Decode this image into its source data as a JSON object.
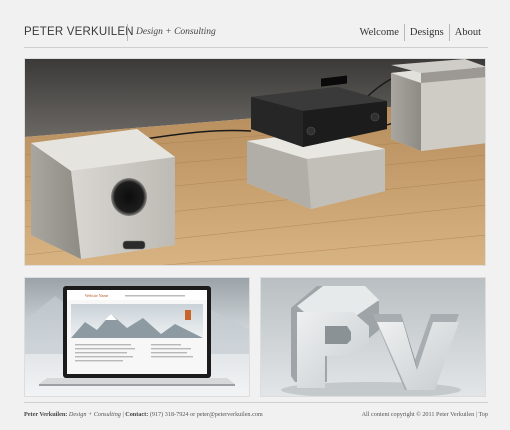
{
  "header": {
    "brand": "PETER VERKUILEN",
    "tagline": "Design + Consulting",
    "nav": [
      {
        "label": "Welcome"
      },
      {
        "label": "Designs"
      },
      {
        "label": "About"
      }
    ]
  },
  "gallery": {
    "hero_alt": "Home theater receiver and speakers render",
    "thumb1_alt": "Laptop showing website design",
    "thumb2_alt": "3D PV logo render",
    "screen_site_title": "Website Name"
  },
  "footer": {
    "name": "Peter Verkuilen:",
    "tagline": "Design + Consulting",
    "sep1": "|",
    "contact_label": "Contact:",
    "phone": "(917) 318-7924",
    "or": "or",
    "email": "peter@peterverkuilen.com",
    "copyright": "All content copyright © 2011 Peter Verkuilen",
    "sep2": "|",
    "top_link": "Top"
  }
}
